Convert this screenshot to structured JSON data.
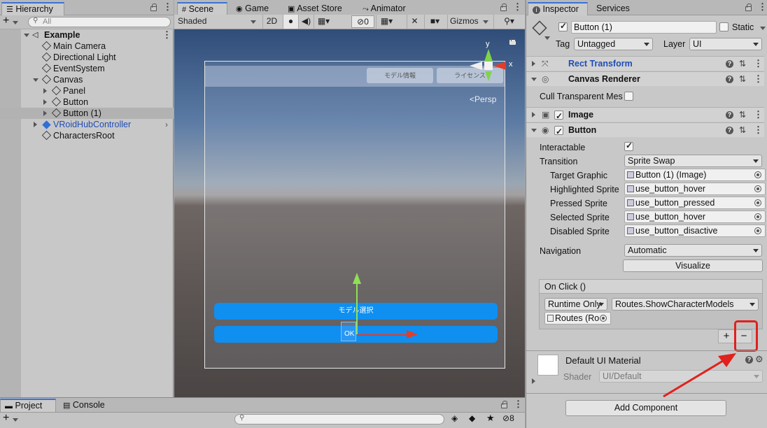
{
  "hierarchy": {
    "tab": "Hierarchy",
    "search_placeholder": "All",
    "rows": [
      {
        "label": "Example"
      },
      {
        "label": "Main Camera"
      },
      {
        "label": "Directional Light"
      },
      {
        "label": "EventSystem"
      },
      {
        "label": "Canvas"
      },
      {
        "label": "Panel"
      },
      {
        "label": "Button"
      },
      {
        "label": "Button (1)"
      },
      {
        "label": "VRoidHubController"
      },
      {
        "label": "CharactersRoot"
      }
    ]
  },
  "scene": {
    "tabs": [
      "Scene",
      "Game",
      "Asset Store",
      "Animator"
    ],
    "shading": "Shaded",
    "mode_2d": "2D",
    "hidden_count": "0",
    "gizmos": "Gizmos",
    "persp": "Persp",
    "canvas_tabs": [
      "モデル情報",
      "ライセンス"
    ],
    "buttons": [
      "モデル選択",
      "OK"
    ],
    "axis": {
      "x": "x",
      "y": "y"
    }
  },
  "bottom": {
    "tabs": [
      "Project",
      "Console"
    ],
    "hidden_count": "8"
  },
  "inspector": {
    "tabs": [
      "Inspector",
      "Services"
    ],
    "object_name": "Button (1)",
    "static_label": "Static",
    "tag_label": "Tag",
    "tag_value": "Untagged",
    "layer_label": "Layer",
    "layer_value": "UI",
    "components": {
      "rect_transform": "Rect Transform",
      "canvas_renderer": "Canvas Renderer",
      "image": "Image",
      "button": "Button"
    },
    "cull_label": "Cull Transparent Mes",
    "props": {
      "interactable": "Interactable",
      "transition": "Transition",
      "transition_value": "Sprite Swap",
      "target_graphic": "Target Graphic",
      "target_graphic_value": "Button (1) (Image)",
      "highlighted": "Highlighted Sprite",
      "highlighted_value": "use_button_hover",
      "pressed": "Pressed Sprite",
      "pressed_value": "use_button_pressed",
      "selected": "Selected Sprite",
      "selected_value": "use_button_hover",
      "disabled": "Disabled Sprite",
      "disabled_value": "use_button_disactive",
      "navigation": "Navigation",
      "navigation_value": "Automatic",
      "visualize": "Visualize"
    },
    "onclick": {
      "title": "On Click ()",
      "runtime": "Runtime Only",
      "function": "Routes.ShowCharacterModels",
      "object": "Routes (Ro",
      "plus": "+",
      "minus": "−"
    },
    "material": {
      "name": "Default UI Material",
      "shader_label": "Shader",
      "shader_value": "UI/Default"
    },
    "add_component": "Add Component"
  },
  "colors": {
    "highlight_red": "#e0211d",
    "scene_button": "#0f8ff0",
    "selection_blue": "#3a72d8"
  }
}
